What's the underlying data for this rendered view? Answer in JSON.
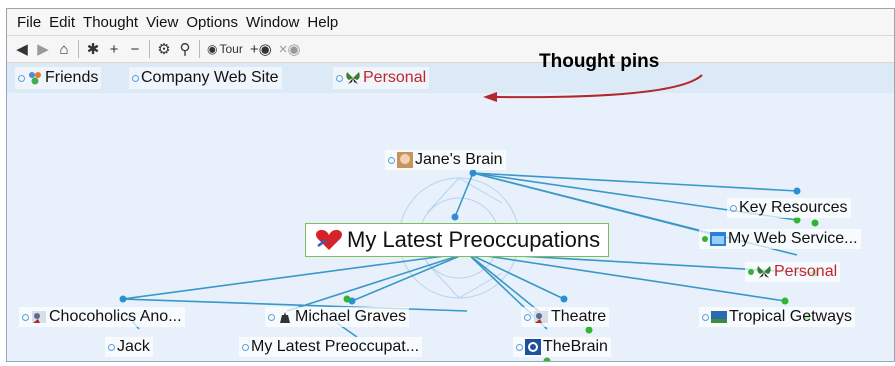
{
  "menu": [
    "File",
    "Edit",
    "Thought",
    "View",
    "Options",
    "Window",
    "Help"
  ],
  "toolbar": {
    "tour_label": "Tour"
  },
  "callout": "Thought pins",
  "pins": [
    {
      "label": "Friends",
      "icon": "people-icon",
      "color": "#111111"
    },
    {
      "label": "Company Web Site",
      "icon": "",
      "color": "#111111"
    },
    {
      "label": "Personal",
      "icon": "butterfly-icon",
      "color": "#c0262a"
    }
  ],
  "plex": {
    "parent": {
      "label": "Jane's Brain",
      "icon": "face-photo-icon"
    },
    "active": {
      "label": "My Latest Preoccupations",
      "icon": "heart-icon"
    },
    "jumps": [
      {
        "label": "Key Resources",
        "icon": ""
      },
      {
        "label": "My Web Service...",
        "icon": "web-icon"
      },
      {
        "label": "Personal",
        "icon": "butterfly-icon",
        "color": "#c0262a"
      }
    ],
    "children": [
      {
        "label": "Chocoholics Ano...",
        "icon": "people-icon"
      },
      {
        "label": "Michael Graves",
        "icon": "kettle-icon"
      },
      {
        "label": "Theatre",
        "icon": "people-icon"
      },
      {
        "label": "Tropical Getways",
        "icon": "photo-icon"
      },
      {
        "label": "Jack",
        "icon": ""
      },
      {
        "label": "My Latest Preoccupat...",
        "icon": ""
      },
      {
        "label": "TheBrain",
        "icon": "brain-logo-icon"
      }
    ]
  },
  "colors": {
    "link": "#3a98c8",
    "accent_red": "#c0262a",
    "active_border": "#7cbf5a",
    "child_dot": "#2fb52f"
  }
}
